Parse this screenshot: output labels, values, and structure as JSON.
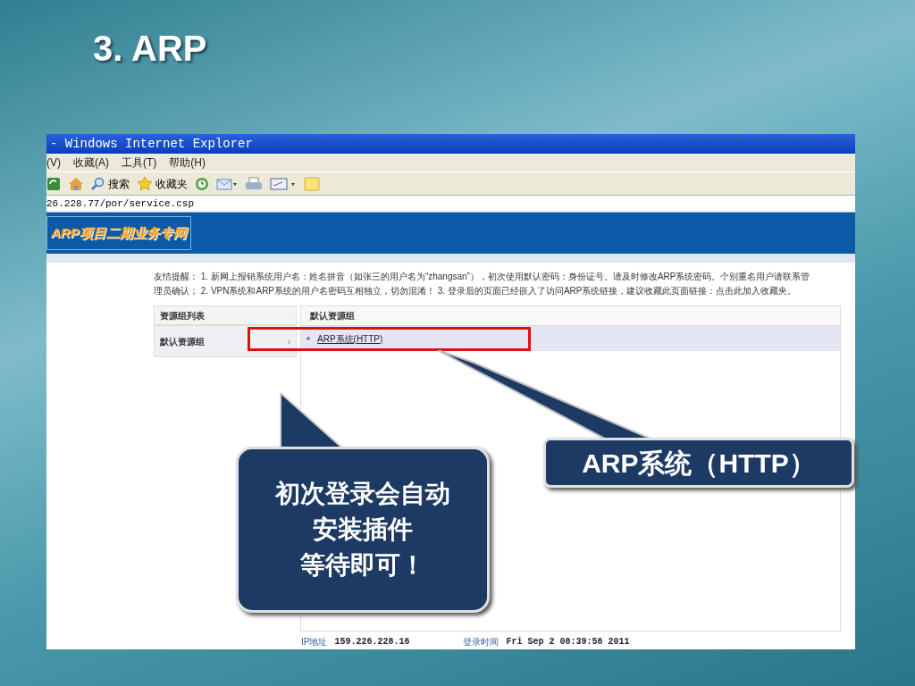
{
  "slide": {
    "title": "3. ARP"
  },
  "browser": {
    "title": "- Windows Internet Explorer",
    "menu": [
      "(V)",
      "收藏(A)",
      "工具(T)",
      "帮助(H)"
    ],
    "toolbar": [
      {
        "kind": "refresh"
      },
      {
        "kind": "home"
      },
      {
        "kind": "search",
        "label": "搜索"
      },
      {
        "kind": "favorites",
        "label": "收藏夹"
      },
      {
        "kind": "history"
      },
      {
        "kind": "mail"
      },
      {
        "kind": "print"
      },
      {
        "kind": "edit"
      },
      {
        "kind": "note"
      }
    ],
    "address": "26.228.77/por/service.csp"
  },
  "page": {
    "logo": "ARP项目二期业务专网",
    "notice": "友情提醒： 1. 新网上报销系统用户名：姓名拼音（如张三的用户名为“zhangsan”），初次使用默认密码：身份证号。请及时修改ARP系统密码。个别重名用户请联系管理员确认； 2. VPN系统和ARP系统的用户名密码互相独立，切勿混淆！ 3. 登录后的页面已经嵌入了访问ARP系统链接，建议收藏此页面链接：点击此加入收藏夹。",
    "left_header": "资源组列表",
    "right_header": "默认资源组",
    "groups": [
      {
        "label": "默认资源组",
        "selected": true,
        "arrow": "›"
      }
    ],
    "resources": [
      {
        "label": "ARP系统(HTTP)",
        "highlighted": true
      }
    ],
    "footer": [
      {
        "label": "IP地址",
        "value": "159.226.228.16"
      },
      {
        "label": "登录时间",
        "value": "Fri Sep 2 08:39:56 2011"
      }
    ]
  },
  "callouts": [
    {
      "kind": "right",
      "text": "ARP系统（HTTP）"
    },
    {
      "kind": "left",
      "lines": [
        "初次登录会自动",
        "安装插件",
        "等待即可！"
      ]
    }
  ]
}
